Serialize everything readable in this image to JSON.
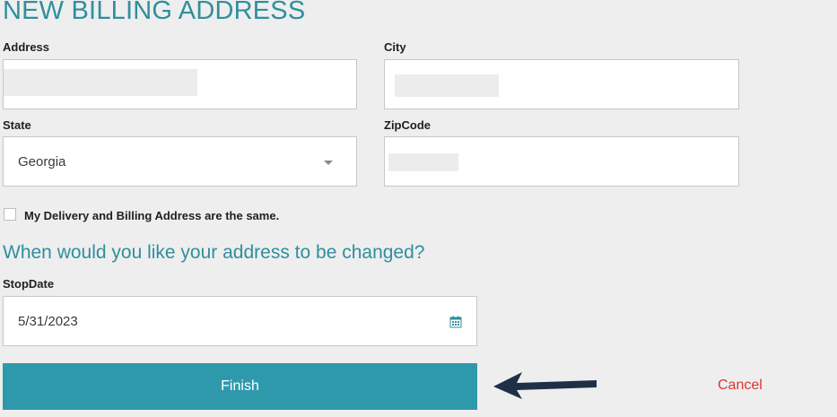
{
  "title": "NEW BILLING ADDRESS",
  "fields": {
    "address_label": "Address",
    "city_label": "City",
    "state_label": "State",
    "state_value": "Georgia",
    "zip_label": "ZipCode"
  },
  "same_address_checkbox": {
    "label": "My Delivery and Billing Address are the same.",
    "checked": false
  },
  "change_section": {
    "heading": "When would you like your address to be changed?",
    "stopdate_label": "StopDate",
    "stopdate_value": "5/31/2023"
  },
  "actions": {
    "finish_label": "Finish",
    "cancel_label": "Cancel"
  },
  "icons": {
    "stopdate": "calendar-icon",
    "state": "chevron-down-icon",
    "annotation": "arrow-left-icon"
  },
  "colors": {
    "accent": "#2f8f9d",
    "button": "#2f99ac",
    "cancel": "#d9372f",
    "background": "#eeeeee"
  }
}
